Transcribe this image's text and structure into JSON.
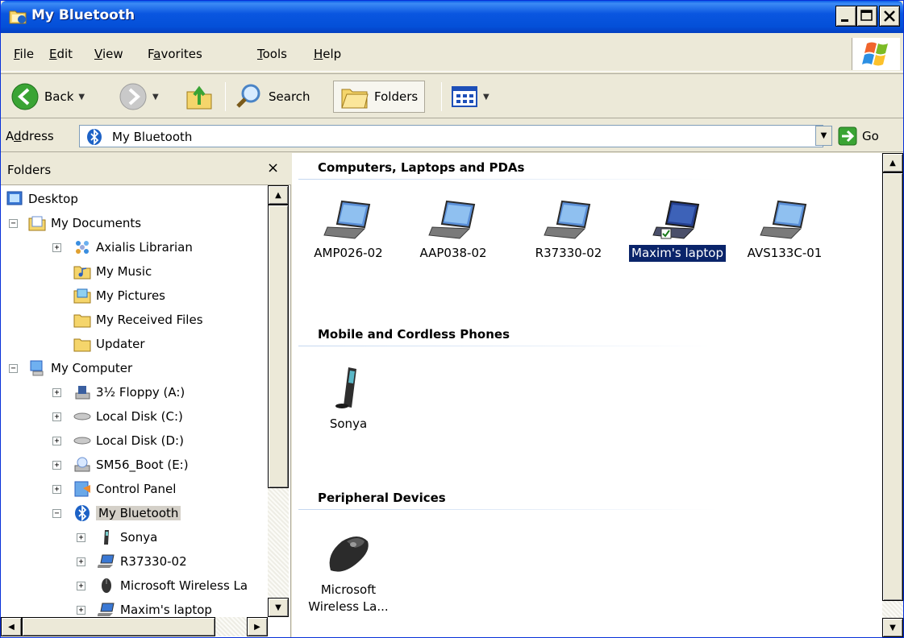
{
  "window": {
    "title": "My Bluetooth",
    "minimize_glyph": "_",
    "maximize_glyph": "□",
    "close_glyph": "×"
  },
  "menu": {
    "items": [
      {
        "label_u": "F",
        "label_rest": "ile"
      },
      {
        "label_u": "E",
        "label_rest": "dit"
      },
      {
        "label_u": "V",
        "label_rest": "iew"
      },
      {
        "label_pre": "F",
        "label_u": "a",
        "label_rest": "vorites"
      },
      {
        "label_u": "T",
        "label_rest": "ools"
      },
      {
        "label_u": "H",
        "label_rest": "elp"
      }
    ]
  },
  "toolbar": {
    "back_label": "Back",
    "search_label": "Search",
    "folders_label": "Folders"
  },
  "address": {
    "label_pre": "A",
    "label_u": "d",
    "label_rest": "dress",
    "value": "My Bluetooth",
    "go_label": "Go"
  },
  "folders_pane": {
    "title": "Folders",
    "close_glyph": "×",
    "tree": [
      {
        "label": "Desktop",
        "icon": "desktop-icon"
      },
      {
        "label": "My Documents",
        "icon": "my-documents-icon",
        "expander": "−"
      },
      {
        "label": "Axialis Librarian",
        "icon": "axialis-icon",
        "expander": "+"
      },
      {
        "label": "My Music",
        "icon": "my-music-icon"
      },
      {
        "label": "My Pictures",
        "icon": "my-pictures-icon"
      },
      {
        "label": "My Received Files",
        "icon": "folder-icon"
      },
      {
        "label": "Updater",
        "icon": "folder-icon"
      },
      {
        "label": "My Computer",
        "icon": "my-computer-icon",
        "expander": "−"
      },
      {
        "label": "3½ Floppy (A:)",
        "icon": "floppy-icon",
        "expander": "+"
      },
      {
        "label": "Local Disk (C:)",
        "icon": "disk-icon",
        "expander": "+"
      },
      {
        "label": "Local Disk (D:)",
        "icon": "disk-icon",
        "expander": "+"
      },
      {
        "label": "SM56_Boot (E:)",
        "icon": "cd-icon",
        "expander": "+"
      },
      {
        "label": "Control Panel",
        "icon": "control-panel-icon",
        "expander": "+"
      },
      {
        "label": "My Bluetooth",
        "icon": "bluetooth-icon",
        "expander": "−"
      },
      {
        "label": "Sonya",
        "icon": "phone-icon",
        "expander": "+"
      },
      {
        "label": "R37330-02",
        "icon": "laptop-icon",
        "expander": "+"
      },
      {
        "label": "Microsoft Wireless La",
        "icon": "mouse-icon",
        "expander": "+"
      },
      {
        "label": "Maxim's laptop",
        "icon": "laptop-icon",
        "expander": "+"
      }
    ]
  },
  "groups": [
    {
      "title": "Computers, Laptops and PDAs",
      "devices": [
        "AMP026-02",
        "AAP038-02",
        "R37330-02",
        "Maxim's laptop",
        "AVS133C-01"
      ]
    },
    {
      "title": "Mobile and Cordless Phones",
      "devices": [
        "Sonya"
      ]
    },
    {
      "title": "Peripheral Devices",
      "devices_lines": [
        "Microsoft",
        "Wireless La..."
      ]
    }
  ],
  "colors": {
    "titlebar": "#0a56e0",
    "selection": "#0a246a",
    "chrome": "#ece9d8"
  }
}
